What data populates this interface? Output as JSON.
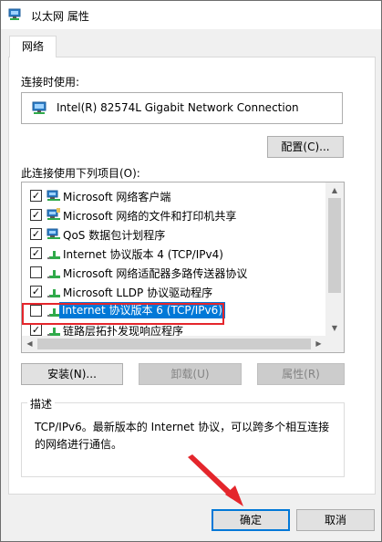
{
  "window": {
    "title": "以太网 属性"
  },
  "tab": {
    "label": "网络"
  },
  "connect_label": "连接时使用:",
  "adapter": {
    "name": "Intel(R) 82574L Gigabit Network Connection"
  },
  "configure_button": "配置(C)...",
  "items_label": "此连接使用下列项目(O):",
  "items": [
    {
      "label": "Microsoft 网络客户端",
      "checked": true,
      "icon": "network-client-icon"
    },
    {
      "label": "Microsoft 网络的文件和打印机共享",
      "checked": true,
      "icon": "file-share-icon"
    },
    {
      "label": "QoS 数据包计划程序",
      "checked": true,
      "icon": "qos-icon"
    },
    {
      "label": "Internet 协议版本 4 (TCP/IPv4)",
      "checked": true,
      "icon": "protocol-icon"
    },
    {
      "label": "Microsoft 网络适配器多路传送器协议",
      "checked": false,
      "icon": "protocol-icon"
    },
    {
      "label": "Microsoft LLDP 协议驱动程序",
      "checked": true,
      "icon": "protocol-icon"
    },
    {
      "label": "Internet 协议版本 6 (TCP/IPv6)",
      "checked": false,
      "icon": "protocol-icon",
      "selected": true
    },
    {
      "label": "链路层拓扑发现响应程序",
      "checked": true,
      "icon": "protocol-icon"
    }
  ],
  "buttons": {
    "install": "安装(N)...",
    "uninstall": "卸载(U)",
    "properties": "属性(R)"
  },
  "description": {
    "legend": "描述",
    "text": "TCP/IPv6。最新版本的 Internet 协议，可以跨多个相互连接的网络进行通信。"
  },
  "footer": {
    "ok": "确定",
    "cancel": "取消"
  },
  "colors": {
    "accent": "#0078d7",
    "highlight_border": "#e4262c",
    "annotation_arrow": "#e4262c"
  }
}
